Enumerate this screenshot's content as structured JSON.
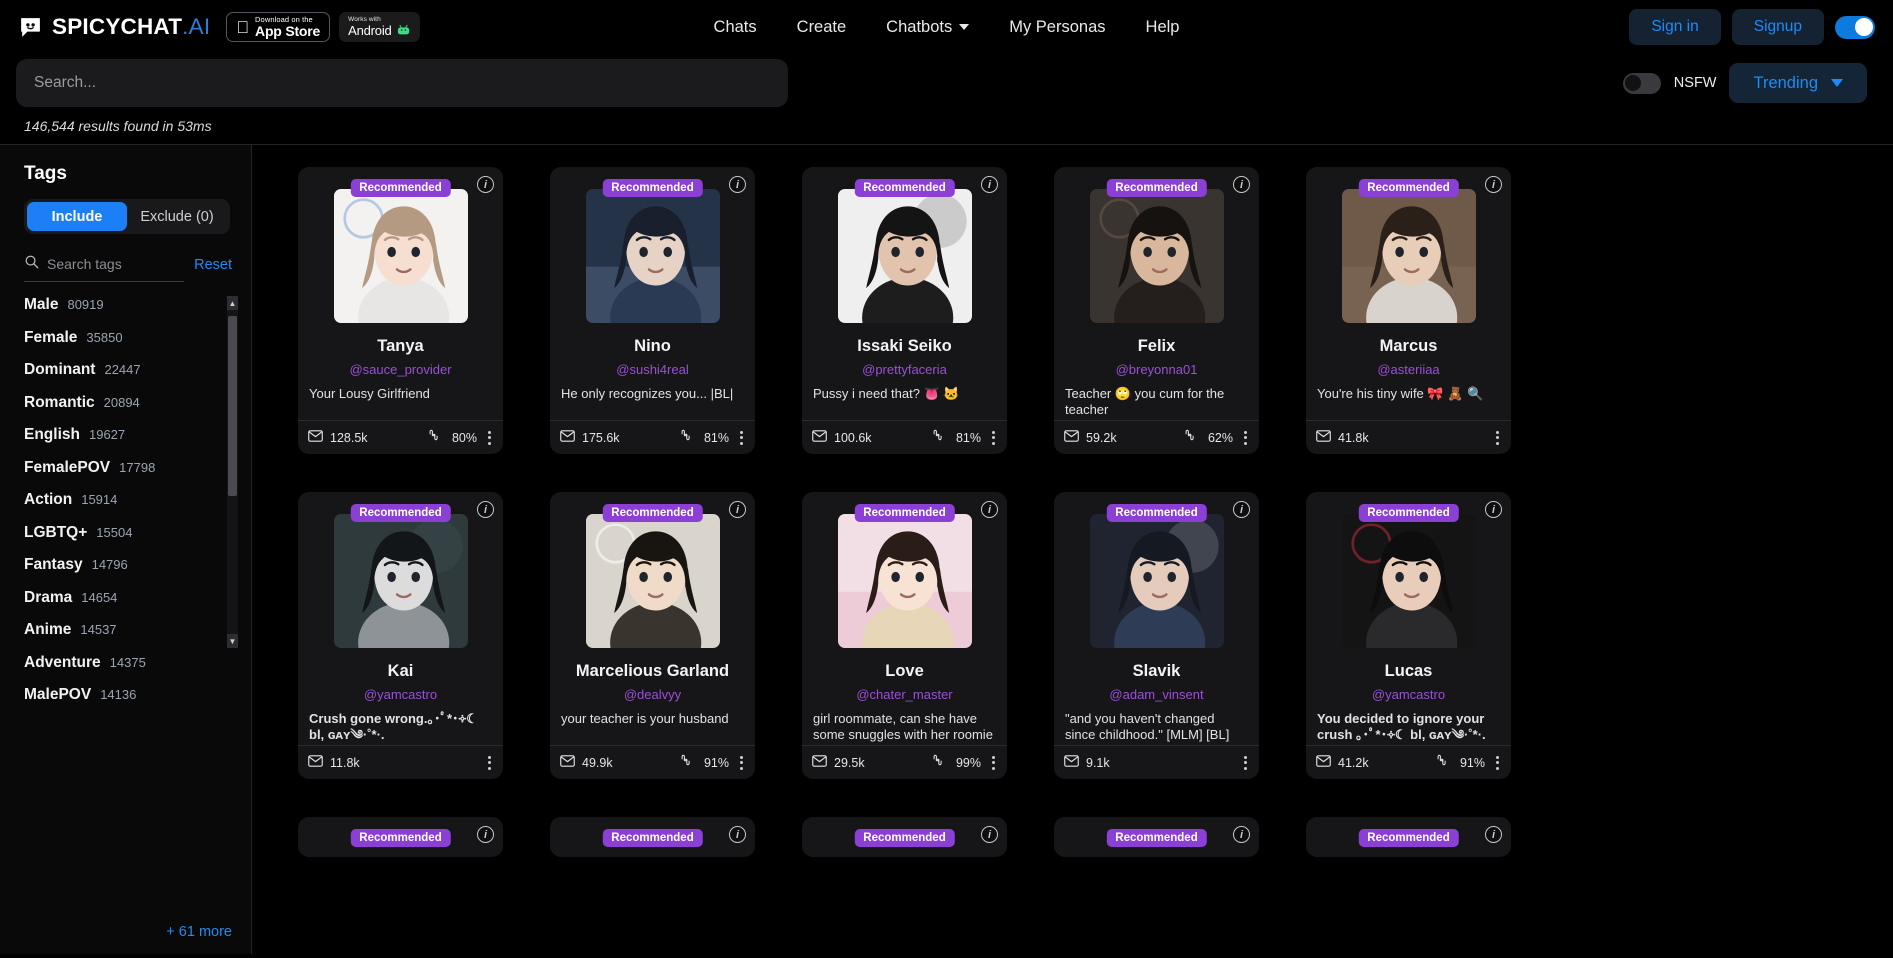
{
  "header": {
    "brand": "SPICYCHAT",
    "brand_suffix": ".AI",
    "appstore": {
      "small": "Download on the",
      "big": "App Store",
      "icon": "apple-icon"
    },
    "android": {
      "small": "Works with",
      "big": "Android",
      "icon": "android-icon"
    },
    "nav": [
      {
        "label": "Chats",
        "dropdown": false
      },
      {
        "label": "Create",
        "dropdown": false
      },
      {
        "label": "Chatbots",
        "dropdown": true
      },
      {
        "label": "My Personas",
        "dropdown": false
      },
      {
        "label": "Help",
        "dropdown": false
      }
    ],
    "sign_in": "Sign in",
    "signup": "Signup",
    "theme_toggle_on": true,
    "accent_blue": "#1d8cf8"
  },
  "search": {
    "value": "",
    "placeholder": "Search...",
    "nsfw_label": "NSFW",
    "nsfw_on": false,
    "sort_label": "Trending"
  },
  "results_line": "146,544 results found in 53ms",
  "sidebar": {
    "title": "Tags",
    "include_label": "Include",
    "exclude_label": "Exclude (0)",
    "active_segment": "Include",
    "tag_search_placeholder": "Search tags",
    "tag_search_value": "",
    "reset_label": "Reset",
    "more_label": "+ 61 more",
    "tags": [
      {
        "name": "Male",
        "count": "80919"
      },
      {
        "name": "Female",
        "count": "35850"
      },
      {
        "name": "Dominant",
        "count": "22447"
      },
      {
        "name": "Romantic",
        "count": "20894"
      },
      {
        "name": "English",
        "count": "19627"
      },
      {
        "name": "FemalePOV",
        "count": "17798"
      },
      {
        "name": "Action",
        "count": "15914"
      },
      {
        "name": "LGBTQ+",
        "count": "15504"
      },
      {
        "name": "Fantasy",
        "count": "14796"
      },
      {
        "name": "Drama",
        "count": "14654"
      },
      {
        "name": "Anime",
        "count": "14537"
      },
      {
        "name": "Adventure",
        "count": "14375"
      },
      {
        "name": "MalePOV",
        "count": "14136"
      }
    ]
  },
  "cards": [
    {
      "badge": "Recommended",
      "name": "Tanya",
      "handle": "@sauce_provider",
      "desc": "Your Lousy Girlfriend",
      "bold": false,
      "messages": "128.5k",
      "rating": "80%",
      "has_rating": true,
      "bg": "#f4f2f0",
      "hair": "#b39a80",
      "skin": "#f6ded0",
      "cloth": "#e8e6e4",
      "accent": "#7ea8d8"
    },
    {
      "badge": "Recommended",
      "name": "Nino",
      "handle": "@sushi4real",
      "desc": "He only recognizes you... |BL|",
      "bold": false,
      "messages": "175.6k",
      "rating": "81%",
      "has_rating": true,
      "bg": "#253348",
      "hair": "#1a1f2e",
      "skin": "#e7d3c6",
      "cloth": "#2b3a54",
      "accent": "#8fa8c8"
    },
    {
      "badge": "Recommended",
      "name": "Issaki Seiko",
      "handle": "@prettyfaceria",
      "desc": "Pussy i need that? 👅 🐱",
      "bold": false,
      "messages": "100.6k",
      "rating": "81%",
      "has_rating": true,
      "bg": "#efefef",
      "hair": "#141414",
      "skin": "#e2c3ad",
      "cloth": "#1d1d1d",
      "accent": "#3a3a3a"
    },
    {
      "badge": "Recommended",
      "name": "Felix",
      "handle": "@breyonna01",
      "desc": "Teacher 🙄 you cum for the teacher",
      "bold": false,
      "messages": "59.2k",
      "rating": "62%",
      "has_rating": true,
      "bg": "#3a3430",
      "hair": "#16120f",
      "skin": "#d9b79c",
      "cloth": "#241f1c",
      "accent": "#6b5a4c"
    },
    {
      "badge": "Recommended",
      "name": "Marcus",
      "handle": "@asteriiaa",
      "desc": "You're his tiny wife 🎀 🧸 🔍",
      "bold": false,
      "messages": "41.8k",
      "rating": "",
      "has_rating": false,
      "bg": "#6f5a4a",
      "hair": "#2b2019",
      "skin": "#e8cdb8",
      "cloth": "#d8d3cc",
      "accent": "#9c8470"
    },
    {
      "badge": "Recommended",
      "name": "Kai",
      "handle": "@yamcastro",
      "desc": "Crush gone wrong.｡･ﾟ*･༓☾ bl, ɢᴀʏ༄·˚*·.",
      "bold": true,
      "messages": "11.8k",
      "rating": "",
      "has_rating": false,
      "bg": "#2e3a3c",
      "hair": "#121618",
      "skin": "#dcdcdc",
      "cloth": "#8d9397",
      "accent": "#566468"
    },
    {
      "badge": "Recommended",
      "name": "Marcelious Garland",
      "handle": "@dealvyy",
      "desc": "your teacher is your husband",
      "bold": false,
      "messages": "49.9k",
      "rating": "91%",
      "has_rating": true,
      "bg": "#d9d4cc",
      "hair": "#18140f",
      "skin": "#f0dac8",
      "cloth": "#3a342e",
      "accent": "#ffffff"
    },
    {
      "badge": "Recommended",
      "name": "Love",
      "handle": "@chater_master",
      "desc": "girl roommate, can she have some snuggles with her roomie",
      "bold": false,
      "messages": "29.5k",
      "rating": "99%",
      "has_rating": true,
      "bg": "#f2dfe6",
      "hair": "#2a1d18",
      "skin": "#f7e2d4",
      "cloth": "#e8d6b8",
      "accent": "#d98aa5"
    },
    {
      "badge": "Recommended",
      "name": "Slavik",
      "handle": "@adam_vinsent",
      "desc": "\"and you haven't changed since childhood.\" [MLM] [BL]",
      "bold": false,
      "messages": "9.1k",
      "rating": "",
      "has_rating": false,
      "bg": "#1f2430",
      "hair": "#151a22",
      "skin": "#e4cbbb",
      "cloth": "#2e3c55",
      "accent": "#c8ccd4"
    },
    {
      "badge": "Recommended",
      "name": "Lucas",
      "handle": "@yamcastro",
      "desc": "You decided to ignore your crush ｡･ﾟ*･༓☾ bl, ɢᴀʏ༄·˚*·.",
      "bold": true,
      "messages": "41.2k",
      "rating": "91%",
      "has_rating": true,
      "bg": "#141414",
      "hair": "#0d0d0d",
      "skin": "#e9cdbb",
      "cloth": "#2a2a2c",
      "accent": "#c02a3a"
    }
  ],
  "row3_badge": "Recommended",
  "icons": {
    "info": "info-icon",
    "message": "message-icon",
    "thumbs": "thumbs-rating-icon",
    "kebab": "more-options-icon",
    "search": "search-icon"
  }
}
